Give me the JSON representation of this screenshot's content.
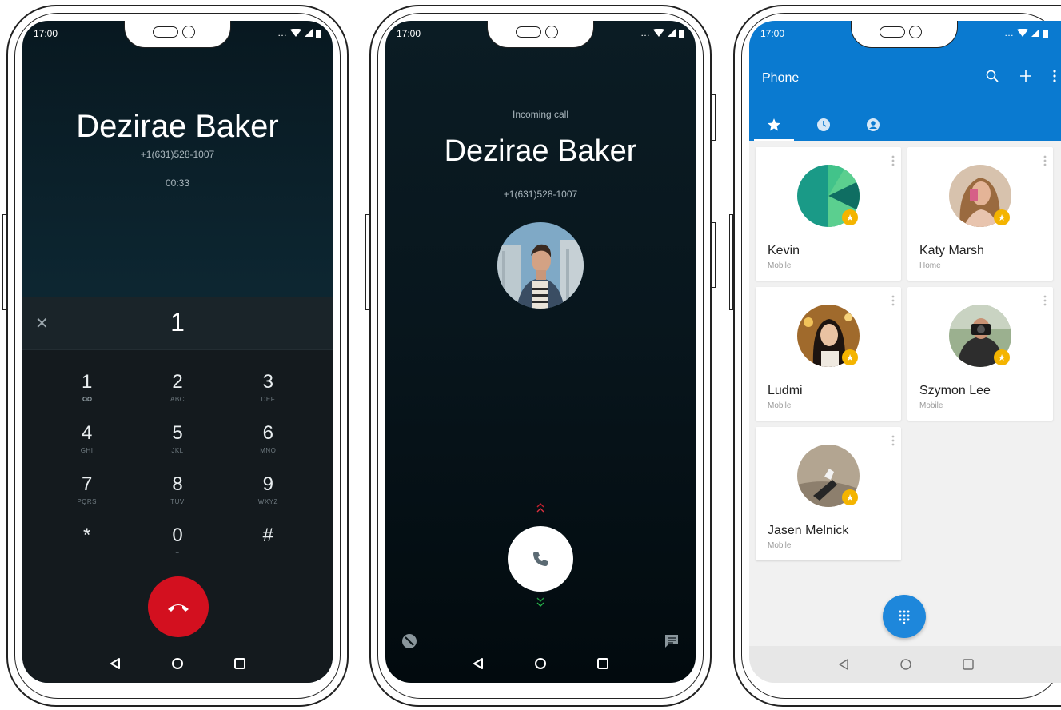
{
  "status_bar": {
    "time": "17:00"
  },
  "screen_ongoing": {
    "contact_name": "Dezirae Baker",
    "phone_number": "+1(631)528-1007",
    "call_timer": "00:33",
    "dialed_digits": "1",
    "keys": [
      {
        "digit": "1",
        "letters": ""
      },
      {
        "digit": "2",
        "letters": "ABC"
      },
      {
        "digit": "3",
        "letters": "DEF"
      },
      {
        "digit": "4",
        "letters": "GHI"
      },
      {
        "digit": "5",
        "letters": "JKL"
      },
      {
        "digit": "6",
        "letters": "MNO"
      },
      {
        "digit": "7",
        "letters": "PQRS"
      },
      {
        "digit": "8",
        "letters": "TUV"
      },
      {
        "digit": "9",
        "letters": "WXYZ"
      },
      {
        "digit": "*",
        "letters": ""
      },
      {
        "digit": "0",
        "letters": "+"
      },
      {
        "digit": "#",
        "letters": ""
      }
    ],
    "end_call_color": "#d3101f"
  },
  "screen_incoming": {
    "label": "Incoming call",
    "contact_name": "Dezirae Baker",
    "phone_number": "+1(631)528-1007"
  },
  "screen_favorites": {
    "title": "Phone",
    "accent_color": "#0a7ad0",
    "tabs": [
      {
        "icon": "star-icon",
        "active": true
      },
      {
        "icon": "clock-icon",
        "active": false
      },
      {
        "icon": "account-circle-icon",
        "active": false
      }
    ],
    "contacts": [
      {
        "name": "Kevin",
        "type": "Mobile"
      },
      {
        "name": "Katy Marsh",
        "type": "Home"
      },
      {
        "name": "Ludmi",
        "type": "Mobile"
      },
      {
        "name": "Szymon Lee",
        "type": "Mobile"
      },
      {
        "name": "Jasen Melnick",
        "type": "Mobile"
      }
    ]
  }
}
